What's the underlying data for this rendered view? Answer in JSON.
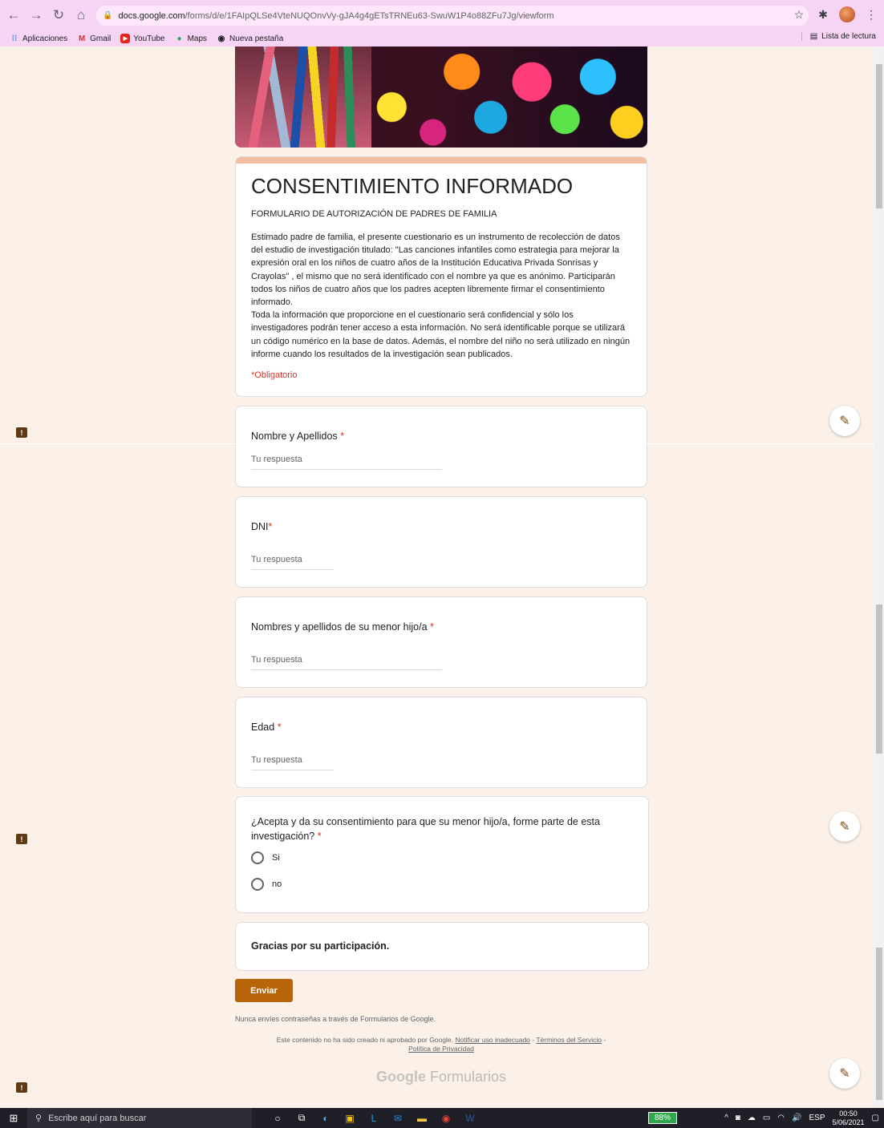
{
  "browser": {
    "url_host": "docs.google.com",
    "url_path": "/forms/d/e/1FAIpQLSe4VteNUQOnvVy-gJA4g4gETsTRNEu63-SwuW1P4o88ZFu7Jg/viewform",
    "bookmarks": [
      {
        "label": "Aplicaciones",
        "icon": "apps-grid-icon"
      },
      {
        "label": "Gmail",
        "icon": "gmail-icon"
      },
      {
        "label": "YouTube",
        "icon": "youtube-icon"
      },
      {
        "label": "Maps",
        "icon": "maps-icon"
      },
      {
        "label": "Nueva pestaña",
        "icon": "globe-icon"
      }
    ],
    "reading_list": "Lista de lectura"
  },
  "form": {
    "title": "CONSENTIMIENTO INFORMADO",
    "subtitle": "FORMULARIO DE AUTORIZACIÓN DE PADRES DE FAMILIA",
    "description": "Estimado padre de familia, el presente cuestionario es un instrumento de recolección de datos del estudio de investigación titulado: \"Las canciones infantiles como estrategia para mejorar la expresión oral en los niños de cuatro años de la Institución Educativa Privada Sonrisas y Crayolas\" , el mismo que no será identificado con el nombre ya que es anónimo. Participarán todos los niños de cuatro años que los padres acepten libremente firmar el consentimiento informado.\nToda la información que proporcione en el cuestionario será confidencial y sólo los investigadores podrán tener acceso a esta información. No será identificable porque se utilizará un código numérico en la base de datos. Además, el nombre del niño no será utilizado en ningún informe cuando los resultados de la investigación sean publicados.",
    "required_note": "*Obligatorio",
    "asterisk": "*",
    "placeholder": "Tu respuesta",
    "questions": [
      {
        "label": "Nombre y Apellidos"
      },
      {
        "label": "DNI"
      },
      {
        "label": "Nombres y apellidos de su menor hijo/a"
      },
      {
        "label": "Edad"
      }
    ],
    "consent_question": {
      "label": "¿Acepta y da su consentimiento para que su menor hijo/a, forme parte de esta investigación?",
      "options": [
        "Si",
        "no"
      ]
    },
    "thanks": "Gracias por su participación.",
    "submit": "Enviar",
    "footer_warning": "Nunca envíes contraseñas a través de Formularios de Google.",
    "footer_disclaimer": "Este contenido no ha sido creado ni aprobado por Google.",
    "footer_links": [
      "Notificar uso inadecuado",
      "Términos del Servicio",
      "Política de Privacidad"
    ],
    "footer_sep": " - ",
    "brand_google": "Google",
    "brand_product": "Formularios"
  },
  "taskbar": {
    "search_placeholder": "Escribe aquí para buscar",
    "battery": "88%",
    "language": "ESP",
    "time": "00:50",
    "date": "5/06/2021"
  }
}
